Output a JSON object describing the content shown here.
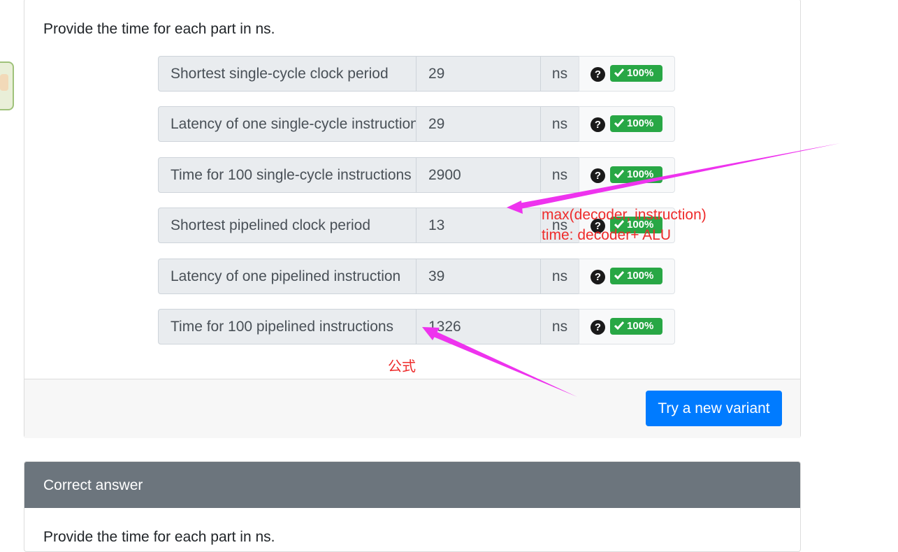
{
  "prompt": "Provide the time for each part in ns.",
  "rows": [
    {
      "label": "Shortest single-cycle clock period",
      "value": "29",
      "unit": "ns",
      "score": "100%"
    },
    {
      "label": "Latency of one single-cycle instruction",
      "value": "29",
      "unit": "ns",
      "score": "100%"
    },
    {
      "label": "Time for 100 single-cycle instructions",
      "value": "2900",
      "unit": "ns",
      "score": "100%"
    },
    {
      "label": "Shortest pipelined clock period",
      "value": "13",
      "unit": "ns",
      "score": "100%"
    },
    {
      "label": "Latency of one pipelined instruction",
      "value": "39",
      "unit": "ns",
      "score": "100%"
    },
    {
      "label": "Time for 100 pipelined instructions",
      "value": "1326",
      "unit": "ns",
      "score": "100%"
    }
  ],
  "help_glyph": "?",
  "try_button": "Try a new variant",
  "correct_answer": {
    "title": "Correct answer",
    "prompt": "Provide the time for each part in ns."
  },
  "annotations": {
    "note_line1": "max(decoder, instruction)",
    "note_line2": "time: decoder+ ALU",
    "formula": "公式"
  },
  "colors": {
    "badge": "#28a745",
    "button": "#007bff",
    "header": "#6c757d",
    "annotation_text": "#ee2b2b",
    "arrow": "#ee33ee"
  }
}
